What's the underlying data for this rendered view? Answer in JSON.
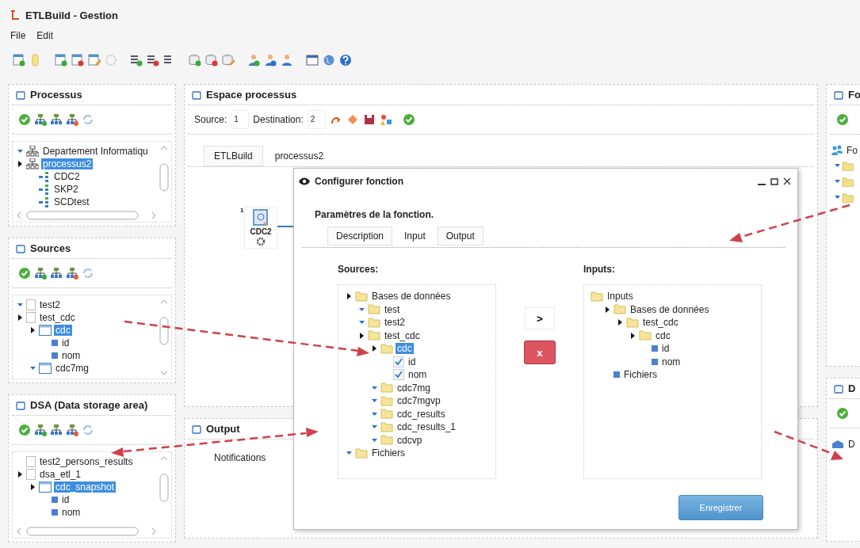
{
  "window": {
    "title": "ETLBuild - Gestion"
  },
  "menu": [
    {
      "label": "File"
    },
    {
      "label": "Edit"
    }
  ],
  "left_panels": [
    {
      "title": "Processus",
      "tree": [
        {
          "label": "Departement Informatiqu",
          "kind": "org",
          "expanded": false,
          "selected": false
        },
        {
          "label": "processus2",
          "kind": "org",
          "expanded": true,
          "selected": true,
          "children": [
            {
              "label": "CDC2",
              "kind": "process",
              "selected": false
            },
            {
              "label": "SKP2",
              "kind": "process",
              "selected": false
            },
            {
              "label": "SCDtest",
              "kind": "process",
              "selected": false
            }
          ]
        }
      ]
    },
    {
      "title": "Sources",
      "tree": [
        {
          "label": "test2",
          "kind": "db",
          "expanded": false,
          "selected": false
        },
        {
          "label": "test_cdc",
          "kind": "db",
          "expanded": true,
          "selected": false,
          "children": [
            {
              "label": "cdc",
              "kind": "table",
              "expanded": true,
              "selected": true,
              "children": [
                {
                  "label": "id",
                  "kind": "column",
                  "selected": false
                },
                {
                  "label": "nom",
                  "kind": "column",
                  "selected": false
                }
              ]
            },
            {
              "label": "cdc7mg",
              "kind": "table",
              "expanded": false,
              "selected": false
            }
          ]
        }
      ]
    },
    {
      "title": "DSA (Data storage area)",
      "tree": [
        {
          "label": "test2_persons_results",
          "kind": "db",
          "selected": false
        },
        {
          "label": "dsa_etl_1",
          "kind": "db",
          "expanded": true,
          "selected": false,
          "children": [
            {
              "label": "cdc_snapshot",
              "kind": "table",
              "expanded": true,
              "selected": true,
              "children": [
                {
                  "label": "id",
                  "kind": "column",
                  "selected": false
                },
                {
                  "label": "nom",
                  "kind": "column",
                  "selected": false
                }
              ]
            }
          ]
        }
      ]
    }
  ],
  "espace": {
    "title": "Espace processus",
    "source": {
      "label": "Source:",
      "value": "1"
    },
    "destination": {
      "label": "Destination:",
      "value": "2"
    },
    "tabs": [
      {
        "label": "ETLBuild",
        "selected": false
      },
      {
        "label": "processus2",
        "selected": true
      }
    ],
    "node": {
      "number": "1",
      "label": "CDC2"
    }
  },
  "output": {
    "title": "Output",
    "tabs": [
      {
        "label": "Notifications",
        "selected": true
      }
    ]
  },
  "right_panels": [
    {
      "title": "Fo",
      "tree_label": "Fo",
      "kind": "function"
    },
    {
      "title": "D",
      "tree_label": "D",
      "kind": "warehouse"
    }
  ],
  "dialog": {
    "title": "Configurer fonction",
    "heading": "Paramètres de la fonction.",
    "tabs": [
      {
        "label": "Description",
        "selected": false
      },
      {
        "label": "Input",
        "selected": true
      },
      {
        "label": "Output",
        "selected": false
      }
    ],
    "sources_label": "Sources:",
    "sources_tree": [
      {
        "label": "Bases de données",
        "kind": "folder",
        "expanded": true,
        "selected": false,
        "children": [
          {
            "label": "test",
            "kind": "folder",
            "expanded": false,
            "selected": false
          },
          {
            "label": "test2",
            "kind": "folder",
            "expanded": false,
            "selected": false
          },
          {
            "label": "test_cdc",
            "kind": "folder",
            "expanded": true,
            "selected": false,
            "children": [
              {
                "label": "cdc",
                "kind": "folder",
                "expanded": true,
                "selected": true,
                "children": [
                  {
                    "label": "id",
                    "kind": "check",
                    "checked": true,
                    "selected": false
                  },
                  {
                    "label": "nom",
                    "kind": "check",
                    "checked": true,
                    "selected": false
                  }
                ]
              },
              {
                "label": "cdc7mg",
                "kind": "folder",
                "expanded": false,
                "selected": false
              },
              {
                "label": "cdc7mgvp",
                "kind": "folder",
                "expanded": false,
                "selected": false
              },
              {
                "label": "cdc_results",
                "kind": "folder",
                "expanded": false,
                "selected": false
              },
              {
                "label": "cdc_results_1",
                "kind": "folder",
                "expanded": false,
                "selected": false
              },
              {
                "label": "cdcvp",
                "kind": "folder",
                "expanded": false,
                "selected": false
              }
            ]
          }
        ]
      },
      {
        "label": "Fichiers",
        "kind": "folder",
        "expanded": false,
        "selected": false
      }
    ],
    "add_button": ">",
    "remove_button": "x",
    "inputs_label": "Inputs:",
    "inputs_tree": [
      {
        "label": "Inputs",
        "kind": "folder",
        "selected": false,
        "children": [
          {
            "label": "Bases de données",
            "kind": "folder",
            "expanded": true,
            "selected": false,
            "children": [
              {
                "label": "test_cdc",
                "kind": "folder",
                "expanded": true,
                "selected": false,
                "children": [
                  {
                    "label": "cdc",
                    "kind": "folder",
                    "expanded": true,
                    "selected": false,
                    "children": [
                      {
                        "label": "id",
                        "kind": "column",
                        "selected": false
                      },
                      {
                        "label": "nom",
                        "kind": "column",
                        "selected": false
                      }
                    ]
                  }
                ]
              }
            ]
          },
          {
            "label": "Fichiers",
            "kind": "column",
            "selected": false
          }
        ]
      }
    ],
    "save_button": "Enregistrer"
  }
}
